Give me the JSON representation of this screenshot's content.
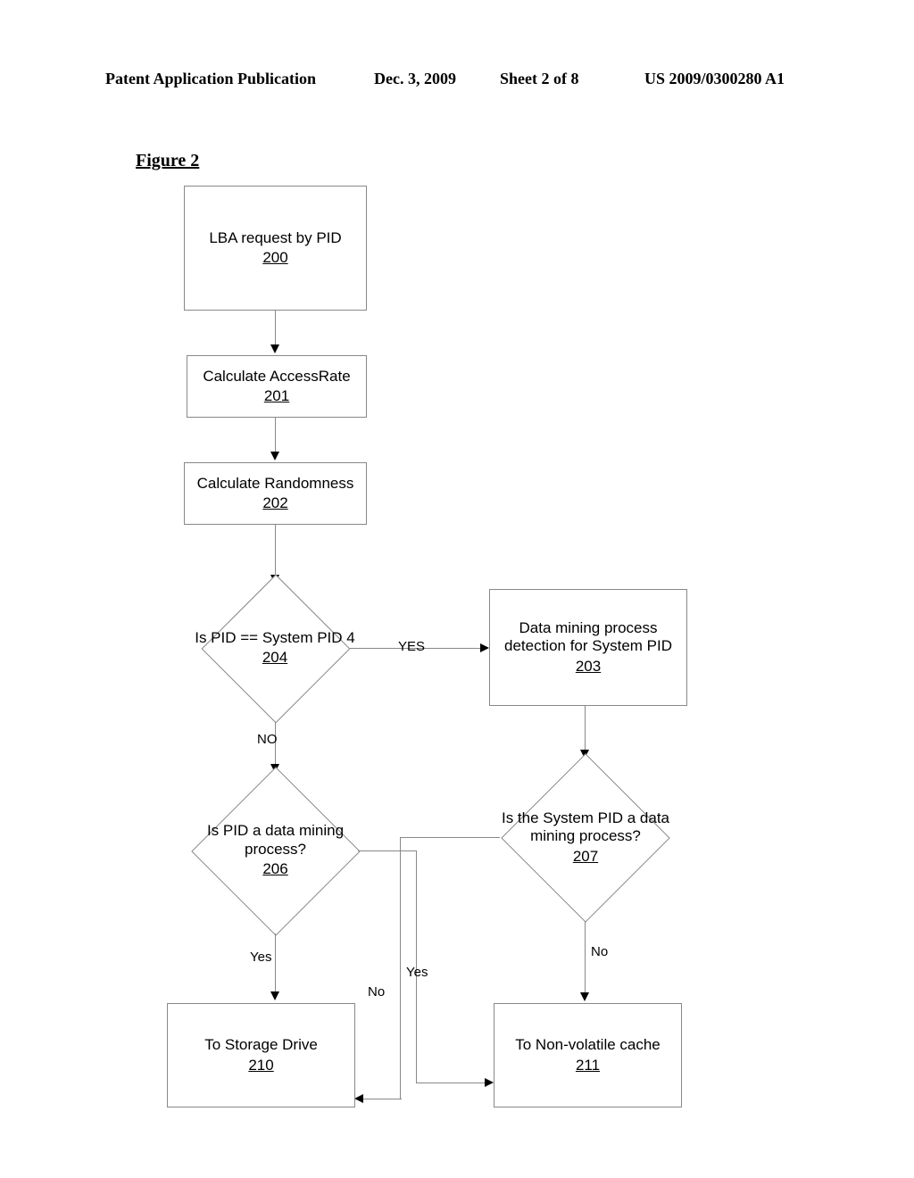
{
  "header": {
    "pub_type": "Patent Application Publication",
    "date": "Dec. 3, 2009",
    "sheet": "Sheet 2 of 8",
    "pub_number": "US 2009/0300280 A1"
  },
  "figure_label": "Figure 2",
  "nodes": {
    "b200": {
      "text": "LBA request by PID",
      "ref": "200"
    },
    "b201": {
      "text": "Calculate AccessRate",
      "ref": "201"
    },
    "b202": {
      "text": "Calculate Randomness",
      "ref": "202"
    },
    "d204": {
      "text": "Is PID == System PID 4",
      "ref": "204"
    },
    "b203": {
      "text": "Data mining process detection for System PID",
      "ref": "203"
    },
    "d206": {
      "text": "Is PID a data mining process?",
      "ref": "206"
    },
    "d207": {
      "text": "Is the System PID a data mining process?",
      "ref": "207"
    },
    "b210": {
      "text": "To Storage Drive",
      "ref": "210"
    },
    "b211": {
      "text": "To Non-volatile cache",
      "ref": "211"
    }
  },
  "edge_labels": {
    "yes204": "YES",
    "no204": "NO",
    "yes206": "Yes",
    "no206": "No",
    "yes207": "Yes",
    "no207": "No"
  }
}
